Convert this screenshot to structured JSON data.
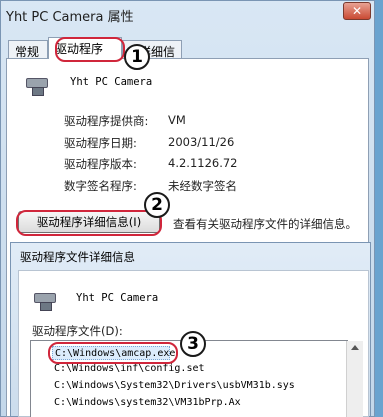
{
  "main_window": {
    "title": "Yht PC Camera 属性",
    "close": "✕",
    "tabs": [
      "常规",
      "驱动程序",
      "详细信息"
    ],
    "device_name": "Yht PC Camera",
    "fields": [
      {
        "label": "驱动程序提供商:",
        "value": "VM"
      },
      {
        "label": "驱动程序日期:",
        "value": "2003/11/26"
      },
      {
        "label": "驱动程序版本:",
        "value": "4.2.1126.72"
      },
      {
        "label": "数字签名程序:",
        "value": "未经数字签名"
      }
    ],
    "details_button": "驱动程序详细信息(I)",
    "details_desc": "查看有关驱动程序文件的详细信息。"
  },
  "details_dialog": {
    "title": "驱动程序文件详细信息",
    "device_name": "Yht PC Camera",
    "files_label": "驱动程序文件(D):",
    "files": [
      "C:\\Windows\\amcap.exe",
      "C:\\Windows\\inf\\config.set",
      "C:\\Windows\\System32\\Drivers\\usbVM31b.sys",
      "C:\\Windows\\system32\\VM31bPrp.Ax"
    ]
  },
  "callouts": [
    "1",
    "2",
    "3"
  ],
  "colors": {
    "highlight_ring": "#d0263b",
    "selected_row": "#dcecfc"
  },
  "icons": [
    "camera-icon",
    "close-icon",
    "scroll-up-icon"
  ]
}
